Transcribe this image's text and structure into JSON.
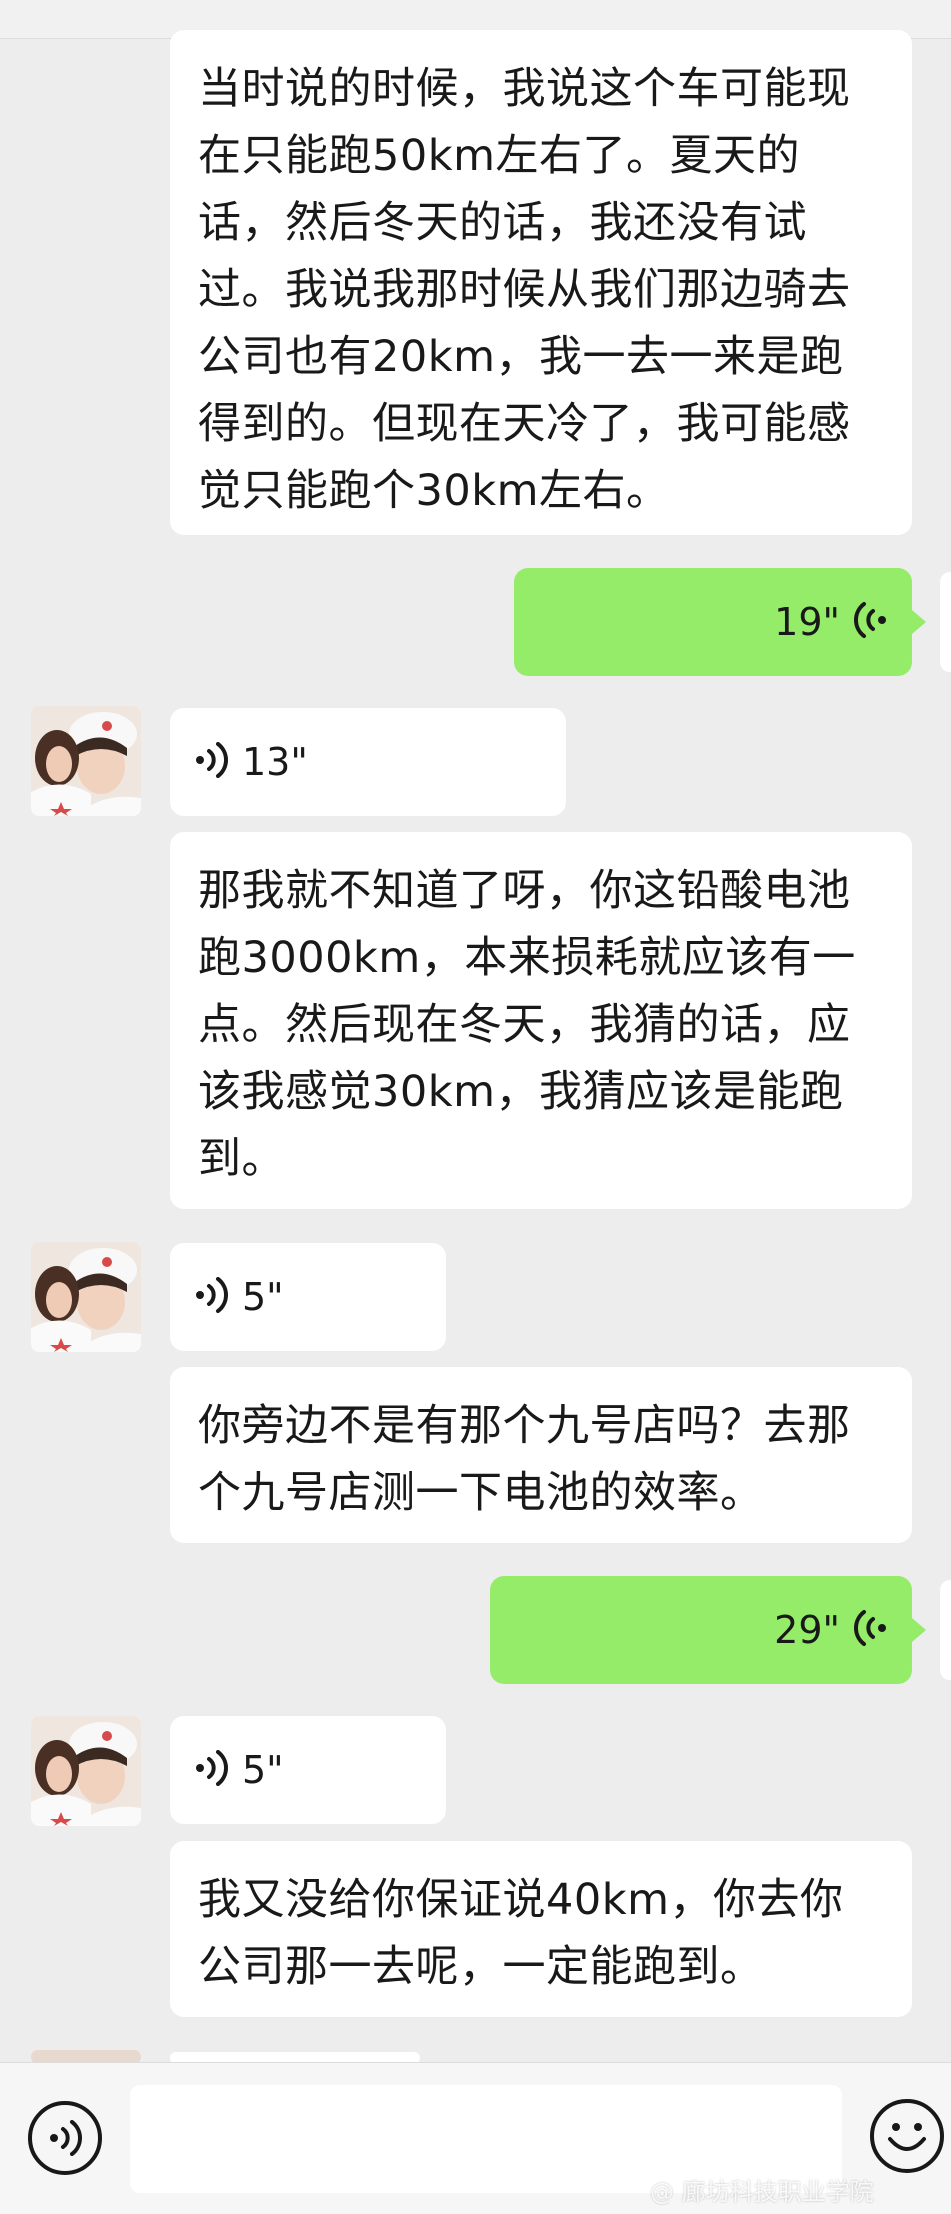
{
  "messages": {
    "m1": {
      "text": "当时说的时候，我说这个车可能现在只能跑50km左右了。夏天的话，然后冬天的话，我还没有试过。我说我那时候从我们那边骑去公司也有20km，我一去一来是跑得到的。但现在天冷了，我可能感觉只能跑个30km左右。"
    },
    "v1": {
      "duration": "19\""
    },
    "v2": {
      "duration": "13\""
    },
    "m2": {
      "text": "那我就不知道了呀，你这铅酸电池跑3000km，本来损耗就应该有一点。然后现在冬天，我猜的话，应该我感觉30km，我猜应该是能跑到。"
    },
    "v3": {
      "duration": "5\""
    },
    "m3": {
      "text": "你旁边不是有那个九号店吗？去那个九号店测一下电池的效率。"
    },
    "v4": {
      "duration": "29\""
    },
    "v5": {
      "duration": "5\""
    },
    "m4": {
      "text": "我又没给你保证说40km，你去你公司那一去呢，一定能跑到。"
    }
  },
  "watermark": {
    "text": "@ 廊坊科技职业学院"
  },
  "colors": {
    "sent_bubble": "#95ec69",
    "received_bubble": "#ffffff",
    "background": "#ededed"
  },
  "icons": {
    "voice_toggle": "voice-input-icon",
    "emoji": "emoji-icon",
    "voice_wave": "voice-wave-icon"
  }
}
